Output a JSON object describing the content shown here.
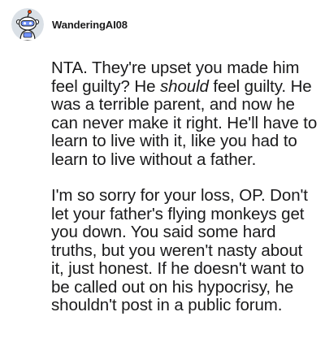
{
  "comment": {
    "username": "WanderingAI08",
    "paragraph1": {
      "before_emphasis": "NTA. They're upset you made him feel guilty? He ",
      "emphasis": "should",
      "after_emphasis": " feel guilty. He was a terrible parent, and now he can never make it right. He'll have to learn to live with it, like you had to learn to live without a father."
    },
    "paragraph2": "I'm so sorry for your loss, OP. Don't let your father's flying monkeys get you down. You said some hard truths, but you weren't nasty about it, just honest. If he doesn't want to be called out on his hypocrisy, he shouldn't post in a public forum."
  },
  "colors": {
    "text": "#1a1a1b",
    "avatar_bg": "#dae0e6",
    "snoo_body": "#ffffff",
    "snoo_outline": "#1c1c1c",
    "snoo_accent": "#7193ff"
  },
  "icons": {
    "avatar": "reddit-snoo-avatar-icon"
  }
}
